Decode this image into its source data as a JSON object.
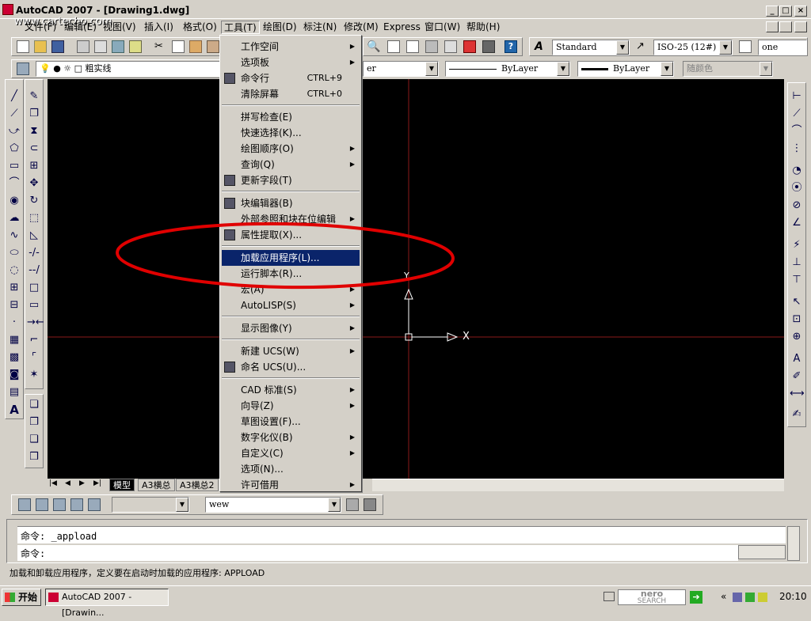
{
  "window": {
    "title": "AutoCAD 2007 - [Drawing1.dwg]",
    "watermark": "www.cartecho.com",
    "min": "_",
    "max": "□",
    "close": "×"
  },
  "menubar": {
    "items": [
      "文件(F)",
      "编辑(E)",
      "视图(V)",
      "插入(I)",
      "格式(O)",
      "工具(T)",
      "绘图(D)",
      "标注(N)",
      "修改(M)",
      "Express",
      "窗口(W)",
      "帮助(H)"
    ]
  },
  "toolbar": {
    "text_style": "Standard",
    "dim_style": "ISO-25 (12#)",
    "table_style": "one",
    "layer": "粗实线",
    "linetype": "ByLayer",
    "lineweight": "ByLayer",
    "color": "随颜色",
    "layer_combo_tail": "er"
  },
  "tools_menu": {
    "items": [
      {
        "label": "工作空间",
        "shortcut": "",
        "submenu": true
      },
      {
        "label": "选项板",
        "shortcut": "",
        "submenu": true
      },
      {
        "label": "命令行",
        "shortcut": "CTRL+9",
        "submenu": false
      },
      {
        "label": "清除屏幕",
        "shortcut": "CTRL+0",
        "submenu": false
      },
      {
        "label": "拼写检查(E)",
        "shortcut": "",
        "submenu": false
      },
      {
        "label": "快速选择(K)...",
        "shortcut": "",
        "submenu": false
      },
      {
        "label": "绘图顺序(O)",
        "shortcut": "",
        "submenu": true
      },
      {
        "label": "查询(Q)",
        "shortcut": "",
        "submenu": true
      },
      {
        "label": "更新字段(T)",
        "shortcut": "",
        "submenu": false
      },
      {
        "label": "块编辑器(B)",
        "shortcut": "",
        "submenu": false
      },
      {
        "label": "外部参照和块在位编辑",
        "shortcut": "",
        "submenu": true
      },
      {
        "label": "属性提取(X)...",
        "shortcut": "",
        "submenu": false
      },
      {
        "label": "加载应用程序(L)...",
        "shortcut": "",
        "submenu": false
      },
      {
        "label": "运行脚本(R)...",
        "shortcut": "",
        "submenu": false
      },
      {
        "label": "宏(A)",
        "shortcut": "",
        "submenu": true
      },
      {
        "label": "AutoLISP(S)",
        "shortcut": "",
        "submenu": true
      },
      {
        "label": "显示图像(Y)",
        "shortcut": "",
        "submenu": true
      },
      {
        "label": "新建 UCS(W)",
        "shortcut": "",
        "submenu": true
      },
      {
        "label": "命名 UCS(U)...",
        "shortcut": "",
        "submenu": false
      },
      {
        "label": "CAD 标准(S)",
        "shortcut": "",
        "submenu": true
      },
      {
        "label": "向导(Z)",
        "shortcut": "",
        "submenu": true
      },
      {
        "label": "草图设置(F)...",
        "shortcut": "",
        "submenu": false
      },
      {
        "label": "数字化仪(B)",
        "shortcut": "",
        "submenu": true
      },
      {
        "label": "自定义(C)",
        "shortcut": "",
        "submenu": true
      },
      {
        "label": "选项(N)...",
        "shortcut": "",
        "submenu": false
      },
      {
        "label": "许可借用",
        "shortcut": "",
        "submenu": true
      }
    ]
  },
  "tabs": [
    "模型",
    "A3横总",
    "A3横总2"
  ],
  "bottom_toolbar": {
    "combo_value": "wew"
  },
  "command": {
    "line1": "命令: _appload",
    "line2": "命令:"
  },
  "statusbar": {
    "text": "加载和卸载应用程序，定义要在启动时加载的应用程序:   APPLOAD"
  },
  "taskbar": {
    "start": "开始",
    "task": "AutoCAD 2007 - [Drawin...",
    "clock": "20:10",
    "nero": "nero",
    "nero_sub": "SEARCH",
    "chevron": "«"
  },
  "ucs": {
    "x_label": "X",
    "y_label": "Y"
  },
  "colors": {
    "canvas": "#000000",
    "highlight": "#0a246a",
    "annotation": "#e00000",
    "crosshair": "#8b1a1a"
  }
}
